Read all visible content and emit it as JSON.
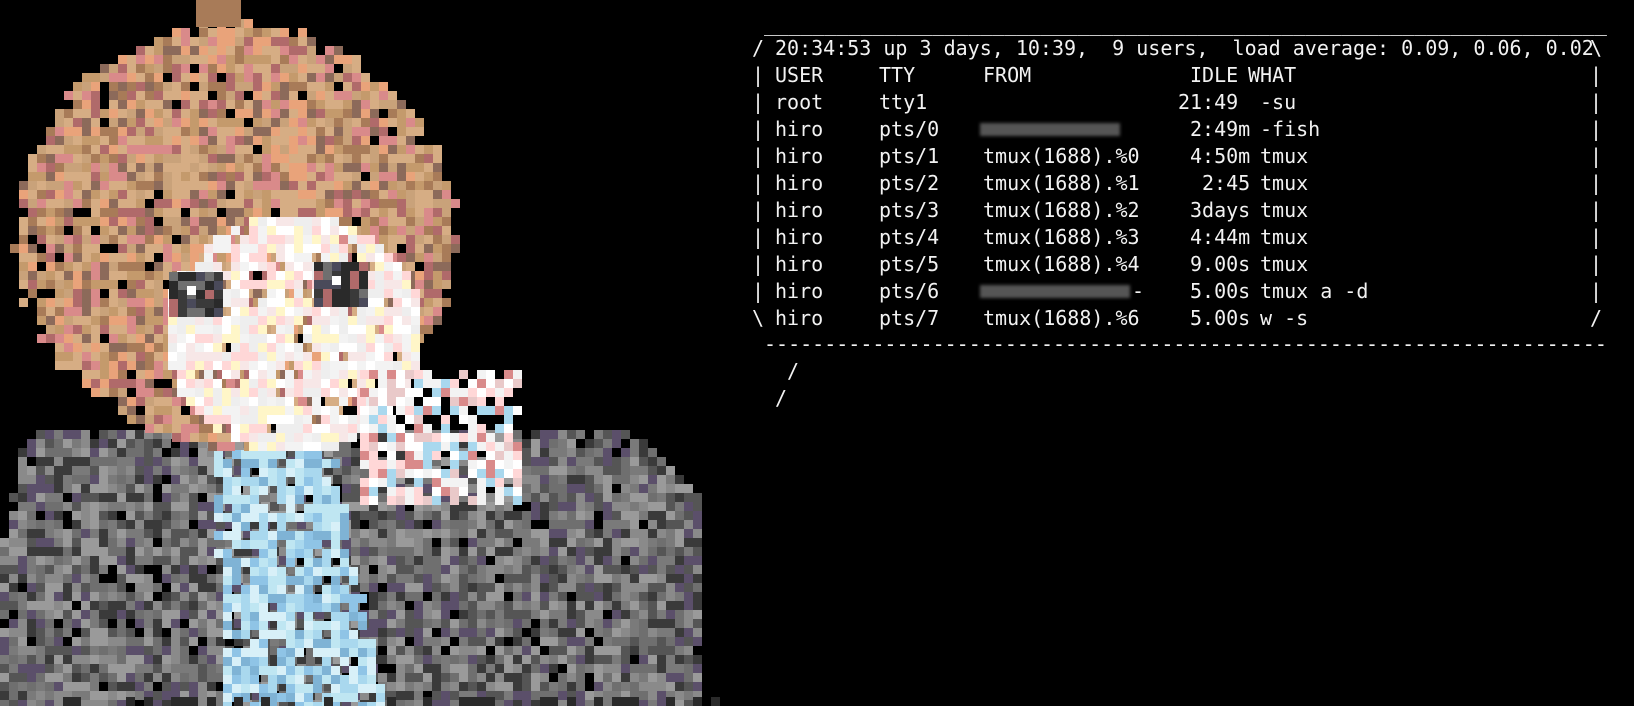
{
  "colors": {
    "background": "#000000",
    "text": "#f2f2f2",
    "redacted": "#777777",
    "art_palette": [
      "#d6ad84",
      "#c49a6c",
      "#a87b58",
      "#d98a8a",
      "#b06a6a",
      "#f3f3f3",
      "#ffffff",
      "#ffd7d7",
      "#fff6c8",
      "#a9d8ee",
      "#8fc4e6",
      "#6f6f6f",
      "#8a8a8a",
      "#555555",
      "#3a3a3a",
      "#2a2a2a",
      "#5b4f6a",
      "#e9a37a"
    ]
  },
  "art": {
    "description_icon": "pixel-art-anime-avatar"
  },
  "speech_bubble": {
    "top_border": "______________________________________________________________________",
    "bottom_border": "----------------------------------------------------------------------",
    "tail_1": "/",
    "tail_2": "/",
    "header": {
      "left": "/",
      "text": "20:34:53 up 3 days, 10:39,  9 users,  load average: 0.09, 0.06, 0.02",
      "right": "\\"
    },
    "columns": {
      "user": "USER",
      "tty": "TTY",
      "from": "FROM",
      "idle": "IDLE",
      "what": "WHAT"
    },
    "rows": [
      {
        "left": "|",
        "user": "root",
        "tty": "tty1",
        "from": "",
        "from_redacted": false,
        "idle": "21:49",
        "what": "-su",
        "right": "|"
      },
      {
        "left": "|",
        "user": "hiro",
        "tty": "pts/0",
        "from": "",
        "from_redacted": true,
        "idle": "2:49m",
        "what": "-fish",
        "right": "|"
      },
      {
        "left": "|",
        "user": "hiro",
        "tty": "pts/1",
        "from": "tmux(1688).%0",
        "from_redacted": false,
        "idle": "4:50m",
        "what": "tmux",
        "right": "|"
      },
      {
        "left": "|",
        "user": "hiro",
        "tty": "pts/2",
        "from": "tmux(1688).%1",
        "from_redacted": false,
        "idle": "2:45",
        "what": "tmux",
        "right": "|"
      },
      {
        "left": "|",
        "user": "hiro",
        "tty": "pts/3",
        "from": "tmux(1688).%2",
        "from_redacted": false,
        "idle": "3days",
        "what": "tmux",
        "right": "|"
      },
      {
        "left": "|",
        "user": "hiro",
        "tty": "pts/4",
        "from": "tmux(1688).%3",
        "from_redacted": false,
        "idle": "4:44m",
        "what": "tmux",
        "right": "|"
      },
      {
        "left": "|",
        "user": "hiro",
        "tty": "pts/5",
        "from": "tmux(1688).%4",
        "from_redacted": false,
        "idle": "9.00s",
        "what": "tmux",
        "right": "|"
      },
      {
        "left": "|",
        "user": "hiro",
        "tty": "pts/6",
        "from": "-",
        "from_redacted": true,
        "idle": "5.00s",
        "what": "tmux a -d",
        "right": "|"
      },
      {
        "left": "\\",
        "user": "hiro",
        "tty": "pts/7",
        "from": "tmux(1688).%6",
        "from_redacted": false,
        "idle": "5.00s",
        "what": "w -s",
        "right": "/"
      }
    ]
  }
}
